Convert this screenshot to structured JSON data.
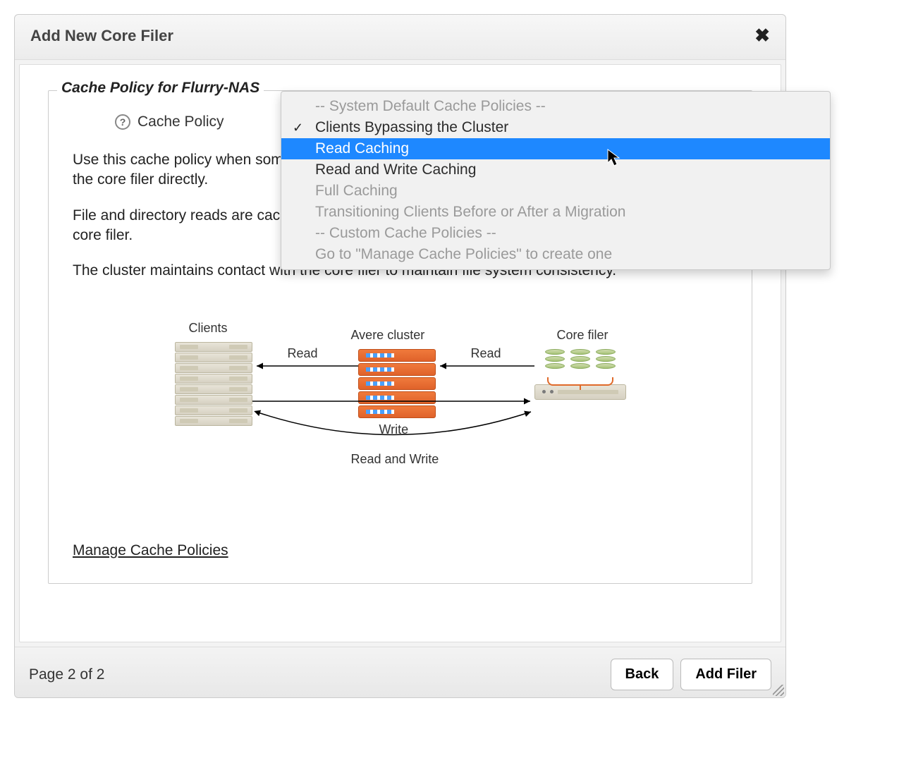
{
  "dialog": {
    "title": "Add New Core Filer",
    "legend": "Cache Policy for Flurry-NAS",
    "cache_policy_label": "Cache Policy",
    "description": {
      "p1": "Use this cache policy when some clients are mounting the Avere cluster and others are mounting the core filer directly.",
      "p2": "File and directory reads are cached. Writes and changes to directory structure pass directly to the core filer.",
      "p3": "The cluster maintains contact with the core filer to maintain file system consistency."
    },
    "manage_link": "Manage Cache Policies",
    "page_indicator": "Page 2 of 2",
    "buttons": {
      "back": "Back",
      "add": "Add Filer"
    }
  },
  "dropdown": {
    "header_system": "-- System Default Cache Policies --",
    "opt_bypass": "Clients Bypassing the Cluster",
    "opt_read": "Read Caching",
    "opt_rw": "Read and Write Caching",
    "opt_full": "Full Caching",
    "opt_transition": "Transitioning Clients Before or After a Migration",
    "header_custom": "-- Custom Cache Policies --",
    "opt_goto": "Go to \"Manage Cache Policies\" to create one",
    "selected": "Clients Bypassing the Cluster",
    "highlighted": "Read Caching"
  },
  "diagram": {
    "clients": "Clients",
    "cluster": "Avere cluster",
    "core": "Core filer",
    "read": "Read",
    "write": "Write",
    "read_and_write": "Read and Write"
  }
}
